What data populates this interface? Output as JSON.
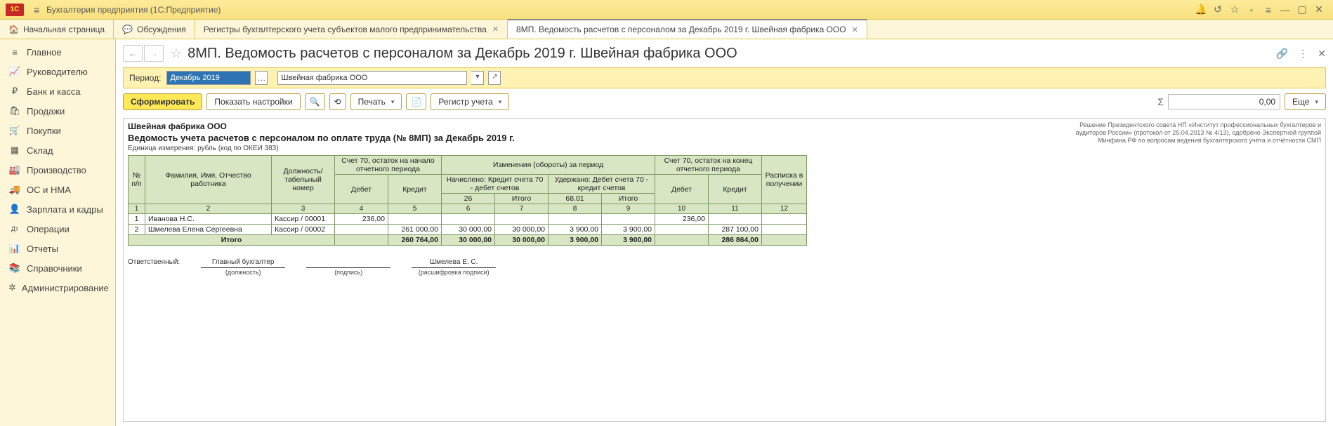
{
  "titlebar": {
    "logo": "1C",
    "app_title": "Бухгалтерия предприятия  (1С:Предприятие)"
  },
  "tabs": {
    "home": "Начальная страница",
    "discussions": "Обсуждения",
    "registers": "Регистры бухгалтерского учета субъектов малого предпринимательства",
    "active": "8МП. Ведомость расчетов с персоналом за Декабрь 2019 г. Швейная фабрика ООО"
  },
  "sidebar": [
    {
      "icon": "≡",
      "label": "Главное"
    },
    {
      "icon": "📈",
      "label": "Руководителю"
    },
    {
      "icon": "₽",
      "label": "Банк и касса"
    },
    {
      "icon": "🛍",
      "label": "Продажи"
    },
    {
      "icon": "🛒",
      "label": "Покупки"
    },
    {
      "icon": "▦",
      "label": "Склад"
    },
    {
      "icon": "🏭",
      "label": "Производство"
    },
    {
      "icon": "🚚",
      "label": "ОС и НМА"
    },
    {
      "icon": "👤",
      "label": "Зарплата и кадры"
    },
    {
      "icon": "Дт",
      "label": "Операции"
    },
    {
      "icon": "📊",
      "label": "Отчеты"
    },
    {
      "icon": "📚",
      "label": "Справочники"
    },
    {
      "icon": "✲",
      "label": "Администрирование"
    }
  ],
  "doc": {
    "title": "8МП. Ведомость расчетов с персоналом за Декабрь 2019 г. Швейная фабрика ООО",
    "period_label": "Период:",
    "period_value": "Декабрь 2019",
    "org_value": "Швейная фабрика ООО"
  },
  "actions": {
    "form": "Сформировать",
    "show_settings": "Показать настройки",
    "print": "Печать",
    "register": "Регистр учета",
    "more": "Еще",
    "sum_value": "0,00"
  },
  "report": {
    "org": "Швейная фабрика ООО",
    "resolution_l1": "Решение Президентского совета НП «Институт профессиональных бухгалтеров и",
    "resolution_l2": "аудиторов России» (протокол от 25.04.2013 № 4/13), одобрено Экспертной группой",
    "resolution_l3": "Минфина РФ по вопросам ведения бухгалтерского учёта и отчётности СМП",
    "title": "Ведомость учета расчетов с персоналом по оплате труда (№ 8МП) за Декабрь 2019 г.",
    "unit": "Единица измерения:  рубль (код по ОКЕИ 383)",
    "headers": {
      "n": "№\nп/п",
      "fio": "Фамилия, Имя, Отчество работника",
      "job": "Должность/\nтабельный номер",
      "start": "Счет 70, остаток на начало\nотчетного периода",
      "debit": "Дебет",
      "credit": "Кредит",
      "changes": "Изменения (обороты) за период",
      "accrued": "Начислено:\nКредит счета 70 - дебет счетов",
      "withheld": "Удержано:\nДебет счета 70 - кредит счетов",
      "c26": "26",
      "c6801": "68.01",
      "itogo": "Итого",
      "end": "Счет 70, остаток на конец\nотчетного периода",
      "rasp": "Расписка\nв получении"
    },
    "colnums": [
      "1",
      "2",
      "3",
      "4",
      "5",
      "6",
      "7",
      "8",
      "9",
      "10",
      "11",
      "12"
    ],
    "rows": [
      {
        "n": "1",
        "fio": "Иванова Н.С.",
        "job": "Кассир / 00001",
        "d4": "236,00",
        "d5": "",
        "d6": "",
        "d7": "",
        "d8": "",
        "d9": "",
        "d10": "236,00",
        "d11": "",
        "d12": ""
      },
      {
        "n": "2",
        "fio": "Шмелева Елена Сергеевна",
        "job": "Кассир / 00002",
        "d4": "",
        "d5": "261 000,00",
        "d6": "30 000,00",
        "d7": "30 000,00",
        "d8": "3 900,00",
        "d9": "3 900,00",
        "d10": "",
        "d11": "287 100,00",
        "d12": ""
      }
    ],
    "total": {
      "label": "Итого",
      "d4": "",
      "d5": "260 764,00",
      "d6": "30 000,00",
      "d7": "30 000,00",
      "d8": "3 900,00",
      "d9": "3 900,00",
      "d10": "",
      "d11": "286 864,00",
      "d12": ""
    },
    "sign": {
      "resp": "Ответственный:",
      "position_value": "Главный бухгалтер",
      "position_label": "(должность)",
      "sign_label": "(подпись)",
      "name_value": "Шмелева Е. С.",
      "name_label": "(расшифровка подписи)"
    }
  }
}
